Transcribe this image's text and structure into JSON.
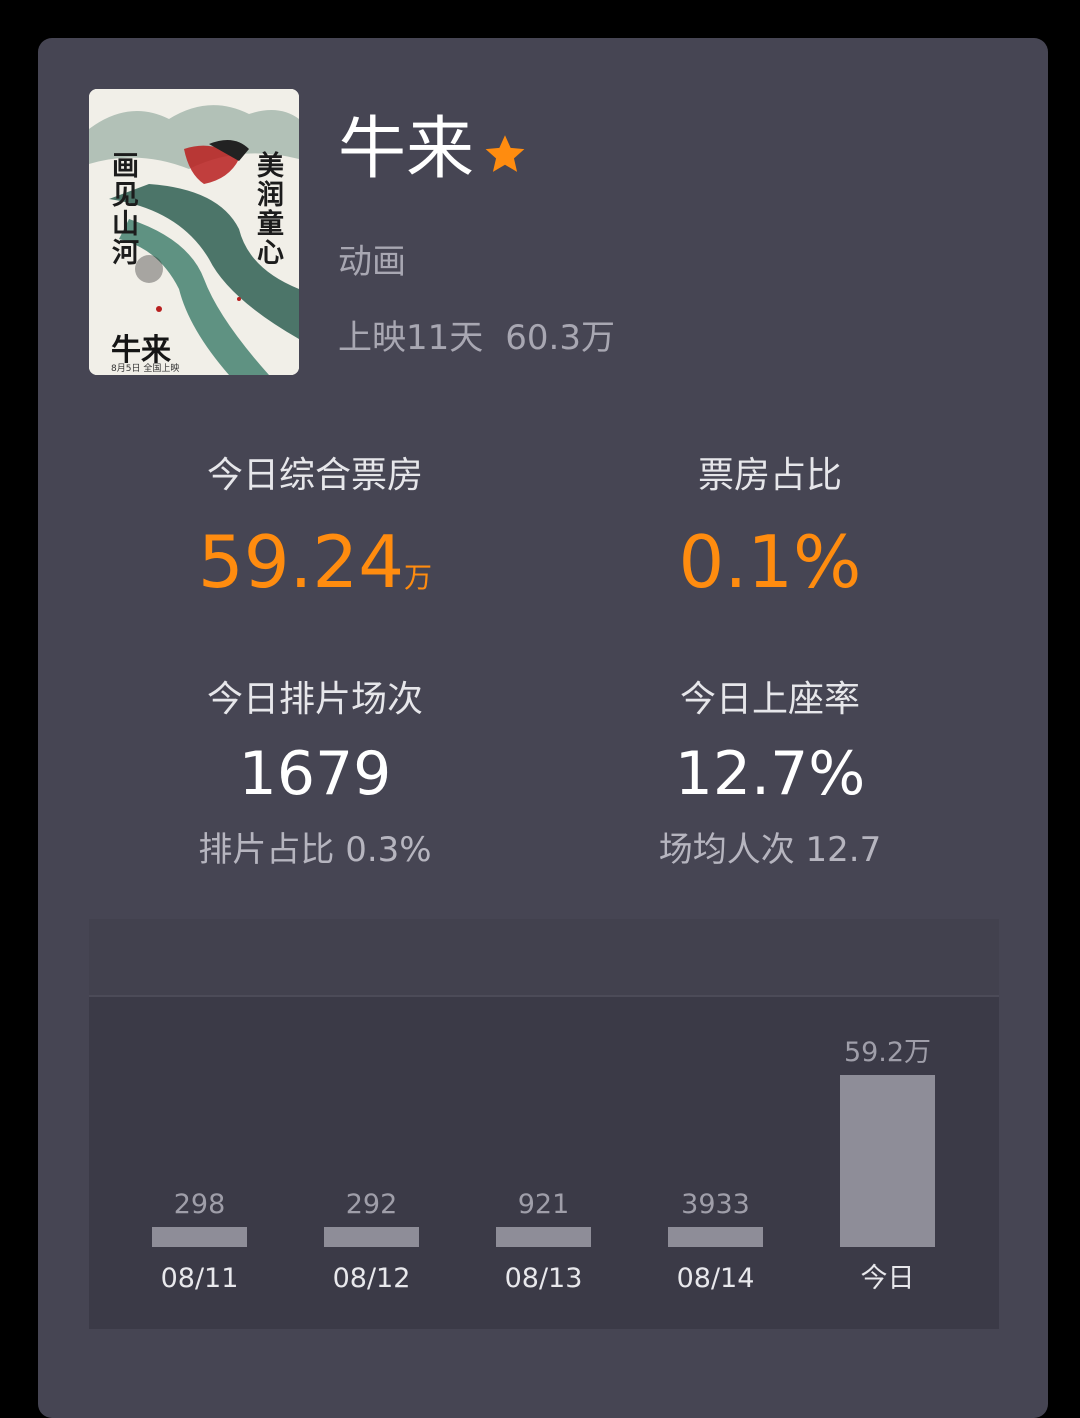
{
  "movie": {
    "title": "牛来",
    "genre": "动画",
    "release_days": "上映11天",
    "total_box": "60.3万",
    "poster": {
      "left_text": "画见山河",
      "right_text": "美润童心",
      "title_text": "牛来",
      "date_text": "8月5日  全国上映"
    }
  },
  "stats": {
    "box_office": {
      "label": "今日综合票房",
      "value": "59.24",
      "unit": "万"
    },
    "box_share": {
      "label": "票房占比",
      "value": "0.1%"
    },
    "shows": {
      "label": "今日排片场次",
      "value": "1679",
      "sub": "排片占比 0.3%"
    },
    "occupancy": {
      "label": "今日上座率",
      "value": "12.7%",
      "sub": "场均人次 12.7"
    }
  },
  "colors": {
    "accent": "#ff8c0f",
    "bar": "#8e8d98",
    "card": "#464553"
  },
  "chart_data": {
    "type": "bar",
    "categories": [
      "08/11",
      "08/12",
      "08/13",
      "08/14",
      "今日"
    ],
    "values": [
      298,
      292,
      921,
      3933,
      592000
    ],
    "value_labels": [
      "298",
      "292",
      "921",
      "3933",
      "59.2万"
    ]
  }
}
